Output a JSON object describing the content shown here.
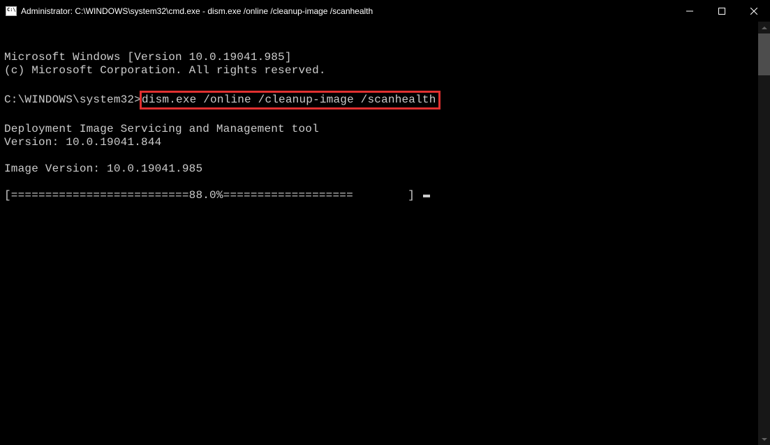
{
  "titlebar": {
    "title": "Administrator: C:\\WINDOWS\\system32\\cmd.exe - dism.exe  /online /cleanup-image /scanhealth"
  },
  "terminal": {
    "line1": "Microsoft Windows [Version 10.0.19041.985]",
    "line2": "(c) Microsoft Corporation. All rights reserved.",
    "blank1": "",
    "prompt_prefix": "C:\\WINDOWS\\system32>",
    "command": "dism.exe /online /cleanup-image /scanhealth",
    "blank2": "",
    "line3": "Deployment Image Servicing and Management tool",
    "line4": "Version: 10.0.19041.844",
    "blank3": "",
    "line5": "Image Version: 10.0.19041.985",
    "blank4": "",
    "progress": "[==========================88.0%===================        ] ",
    "progress_percent": 88.0
  }
}
